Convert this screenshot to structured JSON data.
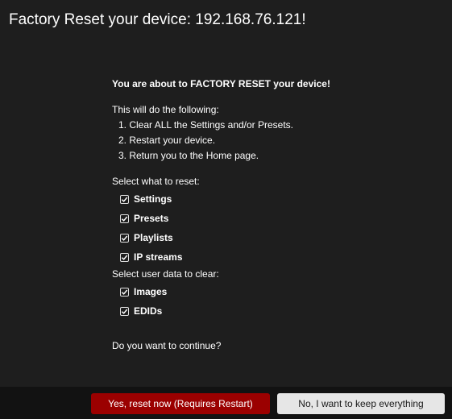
{
  "dialog": {
    "title": "Factory Reset your device: 192.168.76.121!",
    "warning": "You are about to FACTORY RESET your device!",
    "intro": "This will do the following:",
    "steps": [
      "1. Clear ALL the Settings and/or Presets.",
      "2. Restart your device.",
      "3. Return you to the Home page."
    ],
    "reset_label": "Select what to reset:",
    "reset_options": [
      {
        "label": "Settings",
        "checked": true
      },
      {
        "label": "Presets",
        "checked": true
      },
      {
        "label": "Playlists",
        "checked": true
      },
      {
        "label": "IP streams",
        "checked": true
      }
    ],
    "clear_label": "Select user data to clear:",
    "clear_options": [
      {
        "label": "Images",
        "checked": true
      },
      {
        "label": "EDIDs",
        "checked": true
      }
    ],
    "question": "Do you want to continue?"
  },
  "buttons": {
    "confirm": "Yes, reset now (Requires Restart)",
    "cancel": "No, I want to keep everything"
  },
  "colors": {
    "background": "#1e1e1e",
    "footer": "#121212",
    "confirm_button": "#9b0000",
    "cancel_button": "#e6e6e6"
  }
}
